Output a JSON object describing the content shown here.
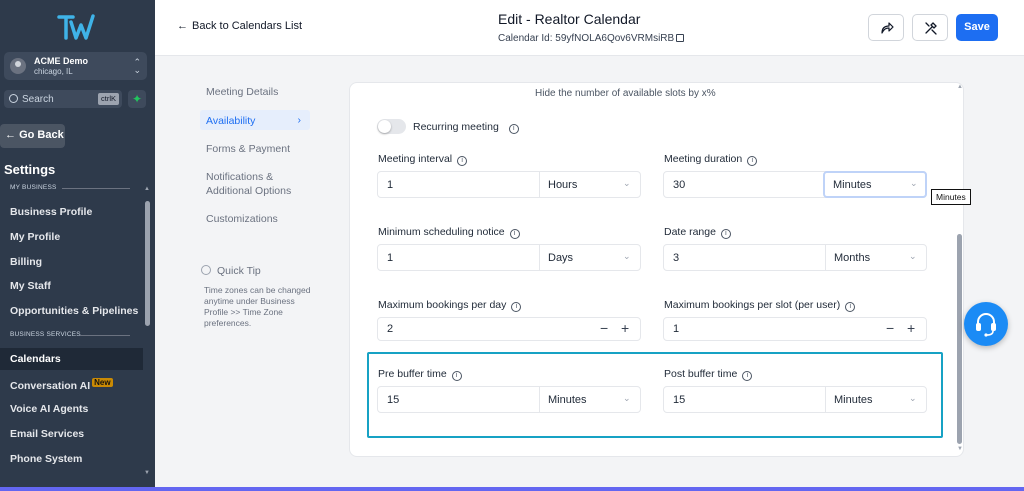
{
  "sidebar": {
    "account": {
      "name": "ACME Demo",
      "location": "chicago, IL"
    },
    "search": {
      "placeholder": "Search",
      "shortcut": "ctrlK"
    },
    "go_back": "Go Back",
    "settings_title": "Settings",
    "sections": [
      {
        "label": "MY BUSINESS"
      },
      {
        "label": "BUSINESS SERVICES"
      }
    ],
    "items": [
      {
        "label": "Business Profile"
      },
      {
        "label": "My Profile"
      },
      {
        "label": "Billing"
      },
      {
        "label": "My Staff"
      },
      {
        "label": "Opportunities & Pipelines"
      },
      {
        "label": "Calendars",
        "active": true
      },
      {
        "label": "Conversation AI",
        "badge": "New"
      },
      {
        "label": "Voice AI Agents"
      },
      {
        "label": "Email Services"
      },
      {
        "label": "Phone System"
      }
    ]
  },
  "header": {
    "back_label": "Back to Calendars List",
    "title": "Edit - Realtor Calendar",
    "calendar_id": "Calendar Id: 59yfNOLA6Qov6VRMsiRB",
    "save_label": "Save"
  },
  "subnav": {
    "items": [
      {
        "label": "Meeting Details"
      },
      {
        "label": "Availability",
        "active": true
      },
      {
        "label": "Forms & Payment"
      },
      {
        "label": "Notifications &\nAdditional Options"
      },
      {
        "label": "Customizations"
      }
    ],
    "quick_tip": {
      "title": "Quick Tip",
      "body": "Time zones can be changed anytime under Business Profile >> Time Zone preferences."
    }
  },
  "form": {
    "hide_slots_text": "Hide the number of available slots by x%",
    "recurring": {
      "label": "Recurring meeting",
      "enabled": false
    },
    "meeting_interval": {
      "label": "Meeting interval",
      "value": "1",
      "unit": "Hours"
    },
    "meeting_duration": {
      "label": "Meeting duration",
      "value": "30",
      "unit": "Minutes"
    },
    "min_notice": {
      "label": "Minimum scheduling notice",
      "value": "1",
      "unit": "Days"
    },
    "date_range": {
      "label": "Date range",
      "value": "3",
      "unit": "Months"
    },
    "max_bookings_day": {
      "label": "Maximum bookings per day",
      "value": "2"
    },
    "max_bookings_slot": {
      "label": "Maximum bookings per slot (per user)",
      "value": "1"
    },
    "pre_buffer": {
      "label": "Pre buffer time",
      "value": "15",
      "unit": "Minutes"
    },
    "post_buffer": {
      "label": "Post buffer time",
      "value": "15",
      "unit": "Minutes"
    }
  },
  "tooltip": "Minutes",
  "colors": {
    "accent": "#1d6ef2",
    "highlight": "#17a2c4",
    "sidebar": "#2e3a4b"
  }
}
